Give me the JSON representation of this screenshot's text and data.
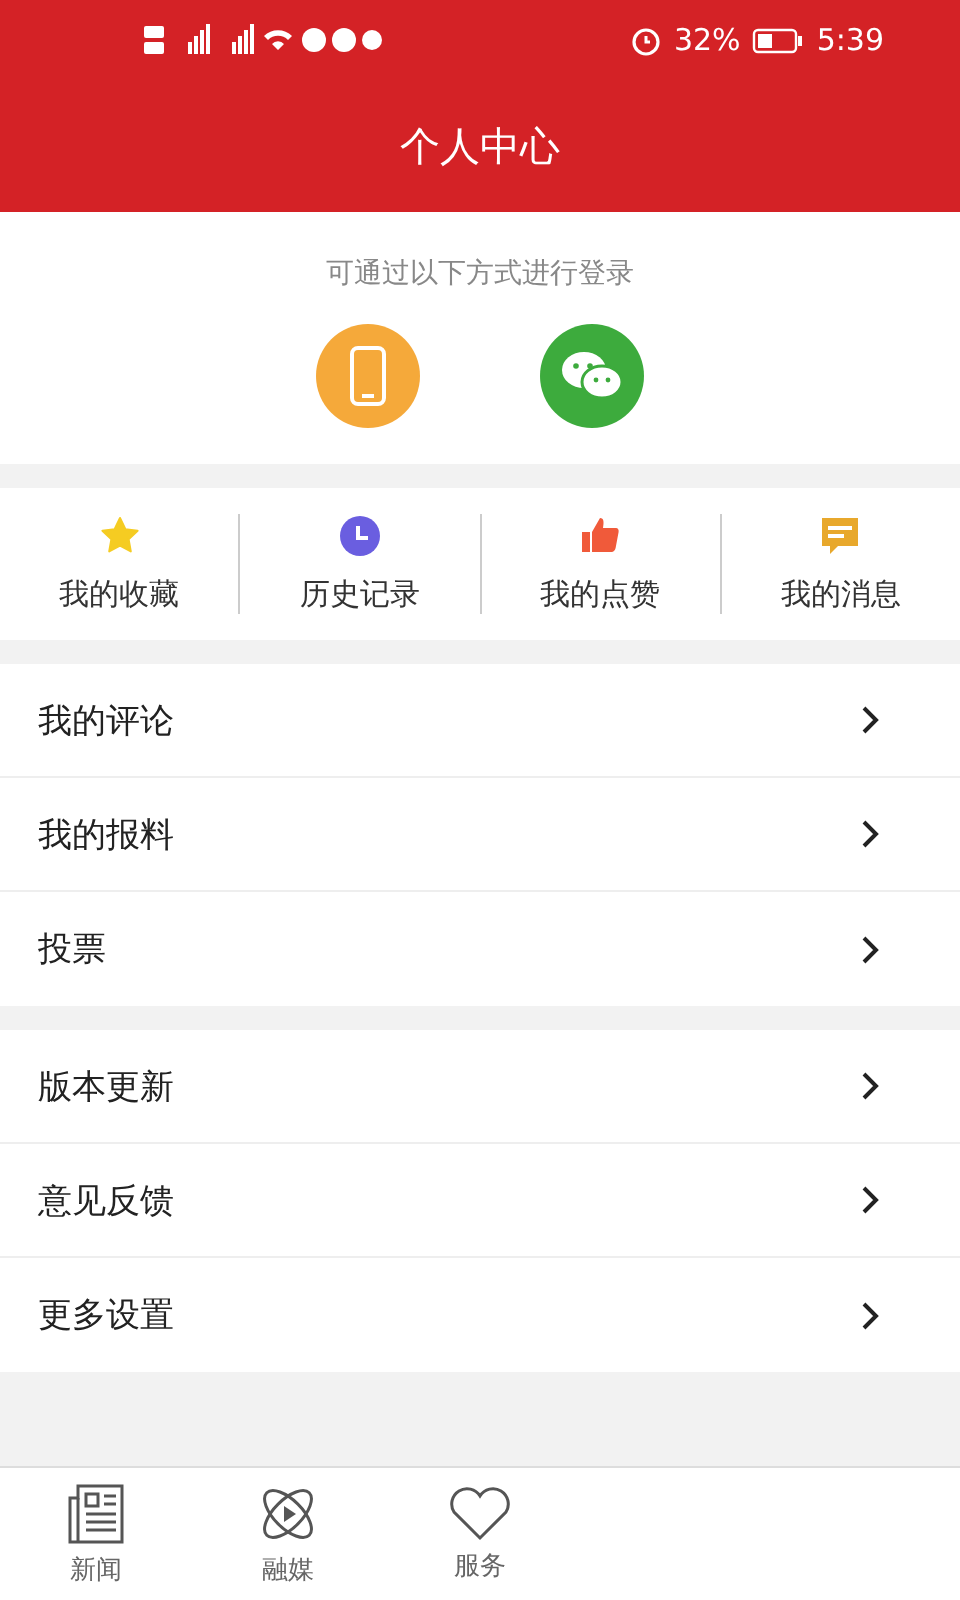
{
  "status_bar": {
    "battery_percent": "32%",
    "time": "5:39"
  },
  "header": {
    "title": "个人中心"
  },
  "login": {
    "hint": "可通过以下方式进行登录",
    "methods": [
      {
        "kind": "phone"
      },
      {
        "kind": "wechat"
      }
    ]
  },
  "shortcuts": [
    {
      "kind": "star",
      "label": "我的收藏"
    },
    {
      "kind": "clock",
      "label": "历史记录"
    },
    {
      "kind": "thumb",
      "label": "我的点赞"
    },
    {
      "kind": "message",
      "label": "我的消息"
    }
  ],
  "menu_groups": [
    [
      {
        "label": "我的评论"
      },
      {
        "label": "我的报料"
      },
      {
        "label": "投票"
      }
    ],
    [
      {
        "label": "版本更新"
      },
      {
        "label": "意见反馈"
      },
      {
        "label": "更多设置"
      }
    ]
  ],
  "tab_bar": [
    {
      "kind": "news",
      "label": "新闻"
    },
    {
      "kind": "media",
      "label": "融媒"
    },
    {
      "kind": "service",
      "label": "服务"
    }
  ]
}
